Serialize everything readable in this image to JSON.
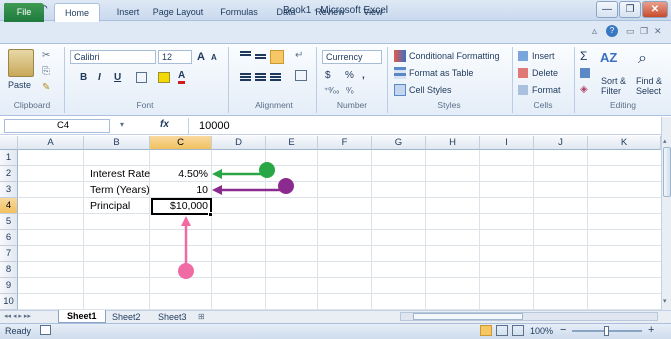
{
  "window": {
    "title": "Book1 - Microsoft Excel",
    "app_icon": "X",
    "qat_save_icon": "save-icon",
    "qat_undo_icon": "undo-icon",
    "qat_redo_icon": "redo-icon",
    "btn_minimize": "—",
    "btn_restore": "❐",
    "btn_close": "✕"
  },
  "tabs": [
    "File",
    "Home",
    "Insert",
    "Page Layout",
    "Formulas",
    "Data",
    "Review",
    "View"
  ],
  "ribbon": {
    "clipboard": {
      "label": "Clipboard",
      "paste": "Paste"
    },
    "font": {
      "label": "Font",
      "name": "Calibri",
      "size": "12",
      "bold": "B",
      "italic": "I",
      "underline": "U",
      "grow": "A",
      "shrink": "A"
    },
    "alignment": {
      "label": "Alignment"
    },
    "number": {
      "label": "Number",
      "format": "Currency",
      "currency_symbol": "$",
      "percent": "%",
      "comma": ",",
      "inc_dec": "⁺⁰⁄₀₀",
      "dec_dec": "⁰⁄₀"
    },
    "styles": {
      "label": "Styles",
      "conditional": "Conditional Formatting",
      "format_table": "Format as Table",
      "cell_styles": "Cell Styles"
    },
    "cells": {
      "label": "Cells",
      "insert": "Insert",
      "delete": "Delete",
      "format": "Format"
    },
    "editing": {
      "label": "Editing",
      "sigma": "Σ",
      "sort_filter_1": "Sort &",
      "sort_filter_2": "Filter",
      "find_select_1": "Find &",
      "find_select_2": "Select"
    }
  },
  "formula_bar": {
    "name_box": "C4",
    "fx": "fx",
    "value": "10000"
  },
  "columns": [
    "A",
    "B",
    "C",
    "D",
    "E",
    "F",
    "G",
    "H",
    "I",
    "J",
    "K"
  ],
  "rows": [
    "1",
    "2",
    "3",
    "4",
    "5",
    "6",
    "7",
    "8",
    "9",
    "10"
  ],
  "cells": {
    "b2": "Interest Rate",
    "c2": "4.50%",
    "b3": "Term (Years)",
    "c3": "10",
    "b4": "Principal",
    "c4": "$10,000"
  },
  "sheets": [
    "Sheet1",
    "Sheet2",
    "Sheet3"
  ],
  "status": {
    "ready": "Ready",
    "zoom": "100%",
    "zoom_minus": "−",
    "zoom_plus": "+"
  },
  "annotation_colors": {
    "green": "#2aa745",
    "purple": "#8c2b8f",
    "pink": "#f06aa4"
  }
}
